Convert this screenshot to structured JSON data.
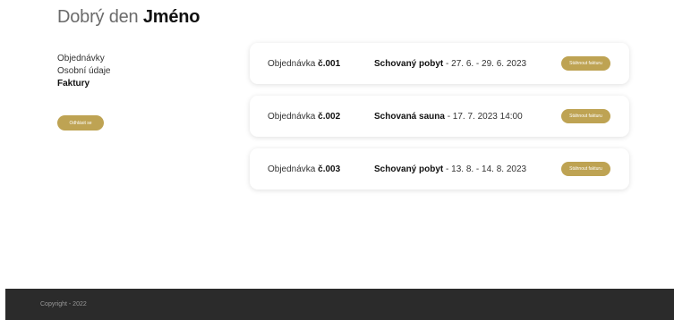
{
  "greeting": {
    "prefix": "Dobrý den",
    "name": "Jméno"
  },
  "sidebar": {
    "items": [
      {
        "label": "Objednávky"
      },
      {
        "label": "Osobní údaje"
      },
      {
        "label": "Faktury",
        "active": true
      }
    ],
    "logout_label": "Odhlásit se"
  },
  "orders": [
    {
      "prefix": "Objednávka",
      "number": "č.001",
      "title": "Schovaný pobyt",
      "detail": " - 27. 6. - 29. 6. 2023",
      "button_label": "Stáhnout fakturu"
    },
    {
      "prefix": "Objednávka",
      "number": "č.002",
      "title": "Schovaná sauna",
      "detail": " - 17. 7. 2023 14:00",
      "button_label": "Stáhnout fakturu"
    },
    {
      "prefix": "Objednávka",
      "number": "č.003",
      "title": "Schovaný pobyt",
      "detail": " - 13. 8. - 14. 8. 2023",
      "button_label": "Stáhnout fakturu"
    }
  ],
  "footer": {
    "copyright": "Copyright - 2022"
  },
  "colors": {
    "accent": "#bea353",
    "footer_bg": "#2b2b2b"
  }
}
